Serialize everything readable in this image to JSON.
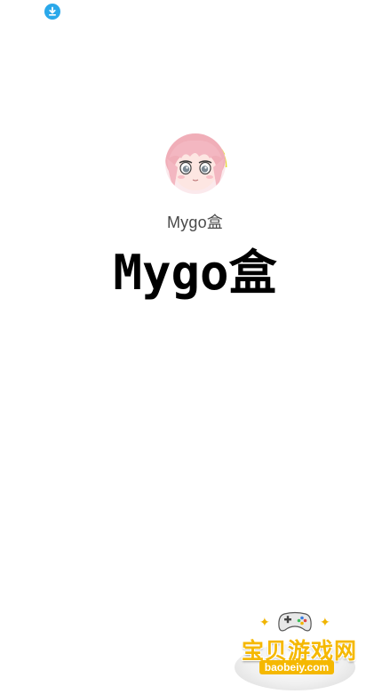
{
  "status_bar": {
    "notification_icon": "download-icon",
    "notification_color": "#2aa8ea"
  },
  "splash": {
    "avatar_icon": "anime-girl-avatar",
    "app_name_small": "Mygo盒",
    "app_name_large": "Mygo盒"
  },
  "watermark": {
    "title": "宝贝游戏网",
    "url": "baobeiy.com",
    "icon": "gamepad-icon",
    "accent_color": "#f5b800"
  }
}
